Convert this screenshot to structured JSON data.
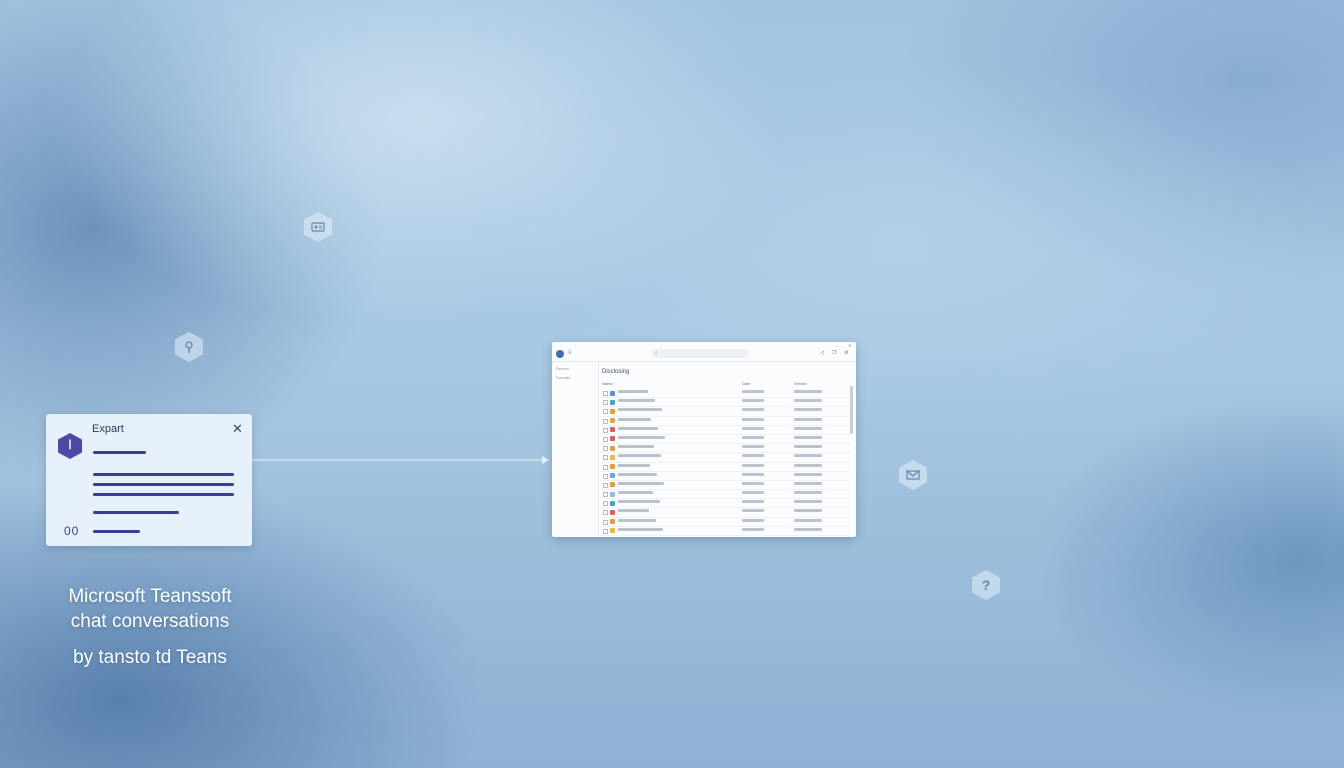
{
  "dialog": {
    "title": "Expart",
    "close_glyph": "✕",
    "app_icon_glyph": "ꟾ",
    "counter": "00"
  },
  "caption": {
    "line1": "Microsoft Teanssoft",
    "line2": "chat conversations",
    "line3": "by tansto td Teans"
  },
  "window": {
    "heading": "Disclosing",
    "search_glyph": "⌕",
    "sidebar": [
      "Recent",
      "Favorite"
    ],
    "columns": [
      "Name",
      "Date",
      "Sender"
    ],
    "row_count": 18,
    "row_icon_colors": [
      "#5b8fd6",
      "#4aa3c7",
      "#e0a040",
      "#e3a23a",
      "#d86060",
      "#d86060",
      "#e0a040",
      "#e8b84a",
      "#e0a040",
      "#6fa8d8",
      "#e0a040",
      "#9bb6d8",
      "#4aa3c7",
      "#d86060",
      "#e0a040",
      "#e8b84a",
      "#d86060",
      "#e0a040"
    ]
  },
  "floating_icons": [
    "contact-card-icon",
    "location-pin-icon",
    "mail-icon",
    "help-icon"
  ],
  "colors": {
    "accent": "#3b3f8f",
    "teams_purple": "#4d4aa6"
  }
}
